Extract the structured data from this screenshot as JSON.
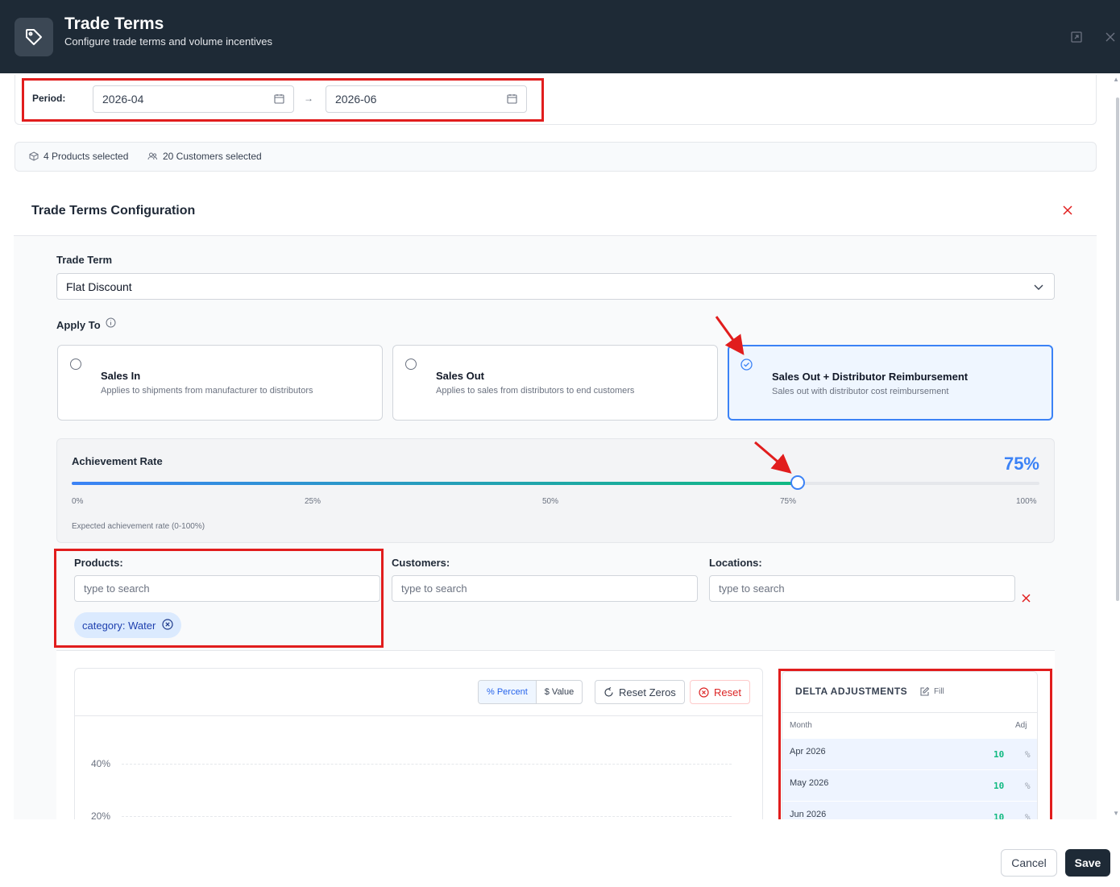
{
  "header": {
    "title": "Trade Terms",
    "subtitle": "Configure trade terms and volume incentives",
    "icon": "tag-icon"
  },
  "period": {
    "label": "Period:",
    "start": "2026-04",
    "end": "2026-06",
    "separator": "→"
  },
  "selection": {
    "products": "4 Products selected",
    "customers": "20 Customers selected"
  },
  "config": {
    "title": "Trade Terms Configuration",
    "trade_term_label": "Trade Term",
    "trade_term_value": "Flat Discount",
    "apply_to_label": "Apply To",
    "options": [
      {
        "title": "Sales In",
        "desc": "Applies to shipments from manufacturer to distributors",
        "selected": false
      },
      {
        "title": "Sales Out",
        "desc": "Applies to sales from distributors to end customers",
        "selected": false
      },
      {
        "title": "Sales Out + Distributor Reimbursement",
        "desc": "Sales out with distributor cost reimbursement",
        "selected": true
      }
    ]
  },
  "achievement": {
    "label": "Achievement Rate",
    "value": 75,
    "value_text": "75%",
    "ticks": [
      "0%",
      "25%",
      "50%",
      "75%",
      "100%"
    ],
    "hint": "Expected achievement rate (0-100%)"
  },
  "filters": {
    "products_label": "Products:",
    "customers_label": "Customers:",
    "locations_label": "Locations:",
    "placeholder": "type to search",
    "chip": "category: Water"
  },
  "chart_toolbar": {
    "percent": "% Percent",
    "value": "$ Value",
    "reset_zeros": "Reset Zeros",
    "reset": "Reset"
  },
  "chart_axis": [
    "40%",
    "20%"
  ],
  "delta": {
    "title": "DELTA ADJUSTMENTS",
    "fill": "Fill",
    "col_month": "Month",
    "col_adj": "Adj",
    "rows": [
      {
        "month": "Apr 2026",
        "adj": "10",
        "unit": "%"
      },
      {
        "month": "May 2026",
        "adj": "10",
        "unit": "%"
      },
      {
        "month": "Jun 2026",
        "adj": "10",
        "unit": "%"
      }
    ]
  },
  "footer": {
    "cancel": "Cancel",
    "save": "Save"
  },
  "colors": {
    "header_bg": "#1e2a36",
    "accent": "#3b82f6",
    "annotation": "#e11d1d",
    "positive": "#10b981"
  }
}
